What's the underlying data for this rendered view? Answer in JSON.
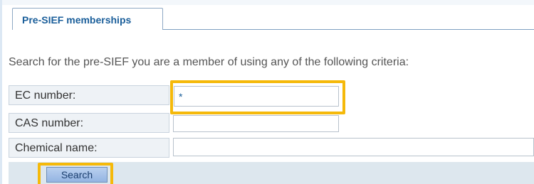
{
  "tabs": [
    {
      "label": "Pre-SIEF memberships"
    }
  ],
  "description": "Search for the pre-SIEF you are a member of using any of the following criteria:",
  "form": {
    "ec_number": {
      "label": "EC number:",
      "value": "*"
    },
    "cas_number": {
      "label": "CAS number:",
      "value": ""
    },
    "chemical_name": {
      "label": "Chemical name:",
      "value": ""
    }
  },
  "actions": {
    "search_label": "Search"
  },
  "colors": {
    "highlight": "#f5b90a",
    "tab_text": "#1a5e9a"
  }
}
